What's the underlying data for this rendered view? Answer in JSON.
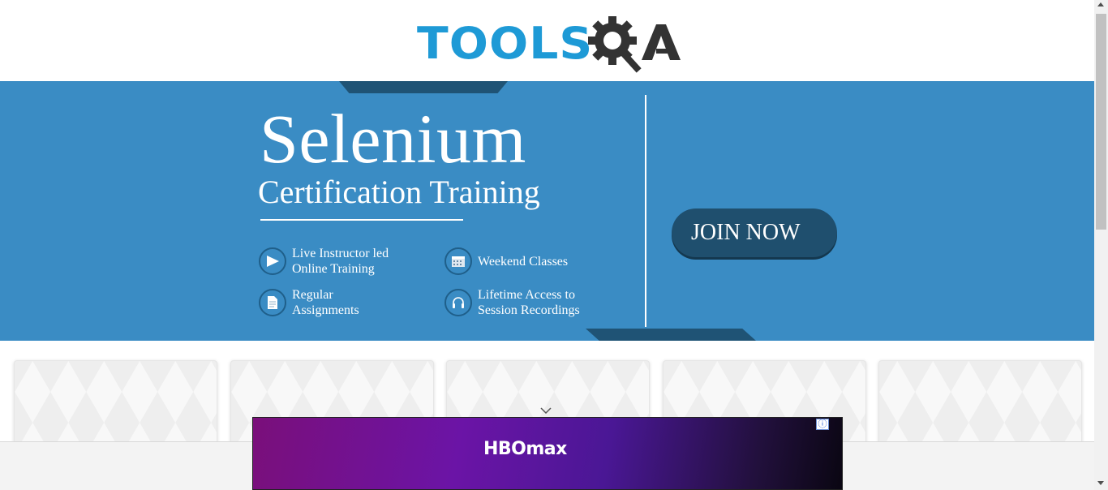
{
  "header": {
    "logo_text": "TOOLS",
    "logo_suffix": "QA"
  },
  "banner": {
    "title": "Selenium",
    "subtitle": "Certification Training",
    "features": [
      {
        "icon": "play-icon",
        "text": "Live Instructor led\nOnline Training"
      },
      {
        "icon": "calendar-icon",
        "text": "Weekend Classes"
      },
      {
        "icon": "document-icon",
        "text": "Regular\nAssignments"
      },
      {
        "icon": "headphones-icon",
        "text": "Lifetime Access to\nSession Recordings"
      }
    ],
    "cta_label": "JOIN NOW"
  },
  "cards": {
    "count": 5
  },
  "ad": {
    "brand": "HBOmax",
    "info_glyph": "ⓘ"
  },
  "colors": {
    "brand_blue": "#1e9ad6",
    "banner_blue": "#3a8cc4",
    "banner_dark": "#1f4f6e",
    "logo_dark": "#333333"
  }
}
